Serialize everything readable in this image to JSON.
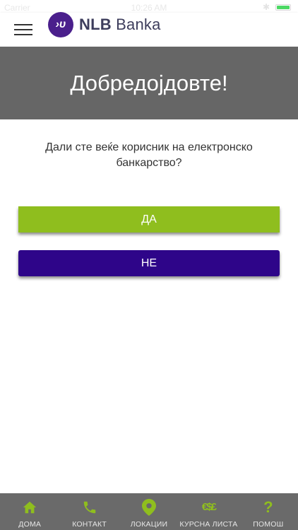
{
  "status_bar": {
    "carrier": "Carrier",
    "time": "10:26 AM",
    "bluetooth": "✱"
  },
  "header": {
    "logo_mark": "›υ",
    "logo_bold": "NLB",
    "logo_rest": "Banka"
  },
  "hero": {
    "title": "Добредојдовте!"
  },
  "question": {
    "text": "Дали сте веќе корисник на електронско банкарство?"
  },
  "buttons": {
    "yes_label": "ДА",
    "no_label": "НЕ"
  },
  "colors": {
    "accent_green": "#8fbe1e",
    "brand_purple": "#2e0589",
    "hero_gray": "#666666",
    "nav_gray": "#6a6a6a"
  },
  "bottom_nav": {
    "items": [
      {
        "label": "ДОМА",
        "icon": "home-icon"
      },
      {
        "label": "КОНТАКТ",
        "icon": "phone-icon"
      },
      {
        "label": "ЛОКАЦИИ",
        "icon": "map-pin-icon"
      },
      {
        "label": "КУРСНА ЛИСТА",
        "icon": "currency-icon"
      },
      {
        "label": "ПОМОШ",
        "icon": "help-icon"
      }
    ],
    "currency_glyph": "€$£",
    "help_glyph": "?"
  }
}
